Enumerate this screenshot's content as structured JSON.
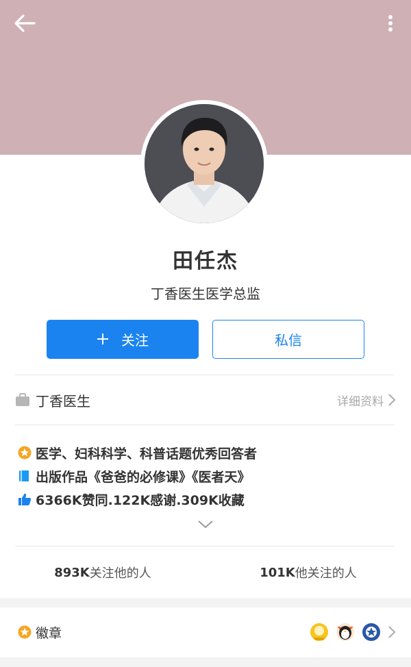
{
  "header": {
    "back_icon": "arrow-left-icon",
    "more_icon": "more-vertical-icon",
    "cover_color": "#cfb0b5"
  },
  "profile": {
    "name": "田任杰",
    "title": "丁香医生医学总监"
  },
  "actions": {
    "follow_label": "关注",
    "message_label": "私信",
    "accent_color": "#1a83f0"
  },
  "organization": {
    "icon": "briefcase-icon",
    "name": "丁香医生",
    "detail_label": "详细资料"
  },
  "highlights": [
    {
      "icon": "star-badge-icon",
      "text": "医学、妇科科学、科普话题优秀回答者"
    },
    {
      "icon": "book-icon",
      "text": "出版作品《爸爸的必修课》《医者天》"
    },
    {
      "icon": "thumbs-up-icon",
      "text": "6366K赞同.122K感谢.309K收藏"
    }
  ],
  "stats": {
    "followers_count": "893K",
    "followers_label": "关注他的人",
    "following_count": "101K",
    "following_label": "他关注的人"
  },
  "badges": {
    "label": "徽章",
    "items": [
      "gold-medal-icon",
      "penguin-icon",
      "blue-emblem-icon"
    ]
  }
}
